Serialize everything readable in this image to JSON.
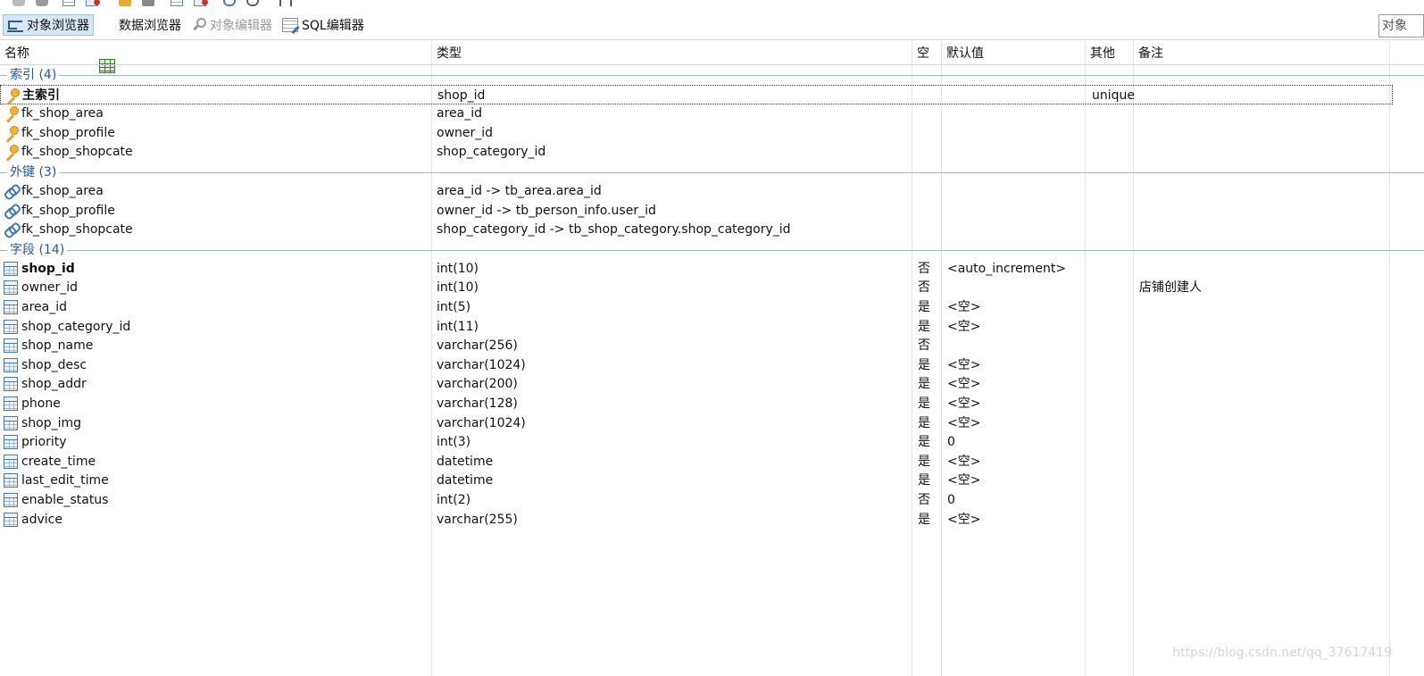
{
  "tabs": [
    {
      "label": "对象浏览器",
      "icon": "object-browser-icon",
      "active": true,
      "disabled": false
    },
    {
      "label": "数据浏览器",
      "icon": "data-browser-icon",
      "active": false,
      "disabled": false
    },
    {
      "label": "对象编辑器",
      "icon": "object-editor-icon",
      "active": false,
      "disabled": true
    },
    {
      "label": "SQL编辑器",
      "icon": "sql-editor-icon",
      "active": false,
      "disabled": false
    }
  ],
  "search": {
    "value": "对象"
  },
  "columns": {
    "name": "名称",
    "type": "类型",
    "null": "空",
    "default": "默认值",
    "other": "其他",
    "comment": "备注"
  },
  "groups": {
    "indexes": "索引 (4)",
    "foreign_keys": "外键 (3)",
    "fields": "字段 (14)"
  },
  "indexes": [
    {
      "name": "主索引",
      "type": "shop_id",
      "other": "unique"
    },
    {
      "name": "fk_shop_area",
      "type": "area_id",
      "other": ""
    },
    {
      "name": "fk_shop_profile",
      "type": "owner_id",
      "other": ""
    },
    {
      "name": "fk_shop_shopcate",
      "type": "shop_category_id",
      "other": ""
    }
  ],
  "foreign_keys": [
    {
      "name": "fk_shop_area",
      "type": "area_id -> tb_area.area_id"
    },
    {
      "name": "fk_shop_profile",
      "type": "owner_id -> tb_person_info.user_id"
    },
    {
      "name": "fk_shop_shopcate",
      "type": "shop_category_id -> tb_shop_category.shop_category_id"
    }
  ],
  "fields": [
    {
      "name": "shop_id",
      "type": "int(10)",
      "null": "否",
      "default": "<auto_increment>",
      "comment": ""
    },
    {
      "name": "owner_id",
      "type": "int(10)",
      "null": "否",
      "default": "",
      "comment": "店铺创建人"
    },
    {
      "name": "area_id",
      "type": "int(5)",
      "null": "是",
      "default": "<空>",
      "comment": ""
    },
    {
      "name": "shop_category_id",
      "type": "int(11)",
      "null": "是",
      "default": "<空>",
      "comment": ""
    },
    {
      "name": "shop_name",
      "type": "varchar(256)",
      "null": "否",
      "default": "",
      "comment": ""
    },
    {
      "name": "shop_desc",
      "type": "varchar(1024)",
      "null": "是",
      "default": "<空>",
      "comment": ""
    },
    {
      "name": "shop_addr",
      "type": "varchar(200)",
      "null": "是",
      "default": "<空>",
      "comment": ""
    },
    {
      "name": "phone",
      "type": "varchar(128)",
      "null": "是",
      "default": "<空>",
      "comment": ""
    },
    {
      "name": "shop_img",
      "type": "varchar(1024)",
      "null": "是",
      "default": "<空>",
      "comment": ""
    },
    {
      "name": "priority",
      "type": "int(3)",
      "null": "是",
      "default": "0",
      "comment": ""
    },
    {
      "name": "create_time",
      "type": "datetime",
      "null": "是",
      "default": "<空>",
      "comment": ""
    },
    {
      "name": "last_edit_time",
      "type": "datetime",
      "null": "是",
      "default": "<空>",
      "comment": ""
    },
    {
      "name": "enable_status",
      "type": "int(2)",
      "null": "否",
      "default": "0",
      "comment": ""
    },
    {
      "name": "advice",
      "type": "varchar(255)",
      "null": "是",
      "default": "<空>",
      "comment": ""
    }
  ],
  "watermark": "https://blog.csdn.net/qq_37617419"
}
